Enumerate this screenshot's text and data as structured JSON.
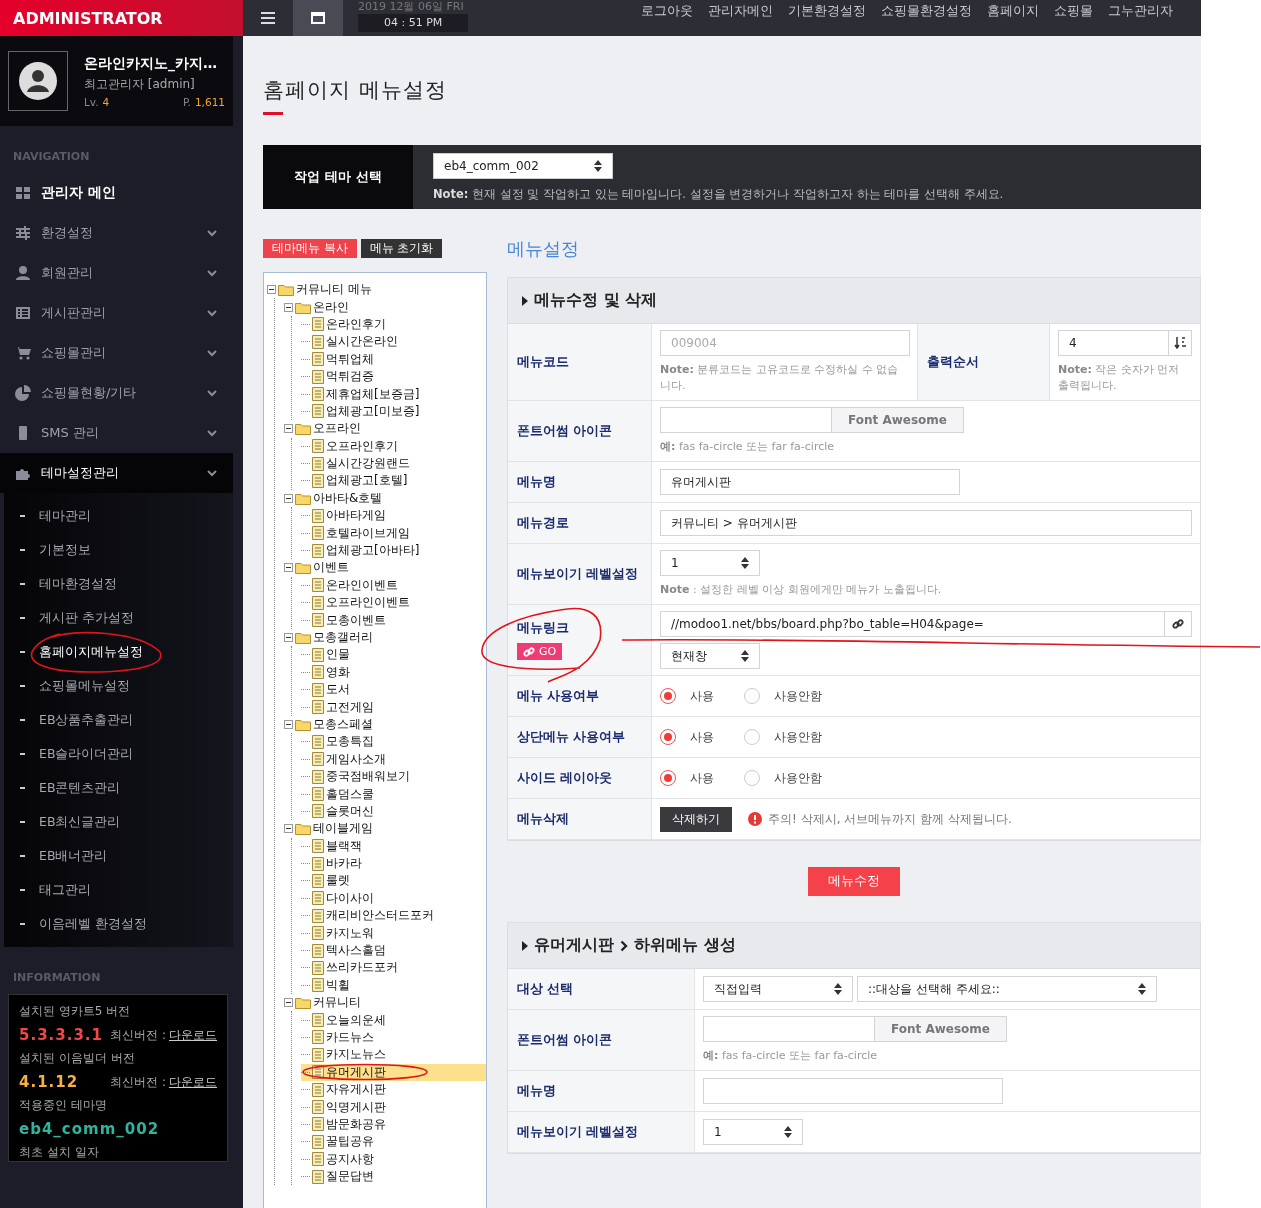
{
  "header": {
    "brand": "ADMINISTRATOR",
    "date": "2019 12월 06일 FRI",
    "time": "04 : 51 PM",
    "links": [
      "로그아웃",
      "관리자메인",
      "기본환경설정",
      "쇼핑몰환경설정",
      "홈페이지",
      "쇼핑몰",
      "그누관리자"
    ]
  },
  "profile": {
    "name": "온라인카지노_카지…",
    "role": "최고관리자 [admin]",
    "lv_label": "Lv.",
    "lv_value": "4",
    "points_label": "P.",
    "points_value": "1,611"
  },
  "navigation": {
    "heading": "NAVIGATION",
    "items": [
      {
        "kind": "link",
        "label": "관리자 메인"
      },
      {
        "kind": "group",
        "label": "환경설정",
        "expanded": false
      },
      {
        "kind": "group",
        "label": "회원관리",
        "expanded": false
      },
      {
        "kind": "group",
        "label": "게시판관리",
        "expanded": false
      },
      {
        "kind": "group",
        "label": "쇼핑몰관리",
        "expanded": false
      },
      {
        "kind": "group",
        "label": "쇼핑몰현황/기타",
        "expanded": false
      },
      {
        "kind": "group",
        "label": "SMS 관리",
        "expanded": false
      },
      {
        "kind": "group",
        "label": "테마설정관리",
        "expanded": true,
        "children": [
          {
            "label": "테마관리",
            "selected": false
          },
          {
            "label": "기본정보",
            "selected": false
          },
          {
            "label": "테마환경설정",
            "selected": false
          },
          {
            "label": "게시판 추가설정",
            "selected": false
          },
          {
            "label": "홈페이지메뉴설정",
            "selected": true
          },
          {
            "label": "쇼핑몰메뉴설정",
            "selected": false
          },
          {
            "label": "EB상품추출관리",
            "selected": false
          },
          {
            "label": "EB슬라이더관리",
            "selected": false
          },
          {
            "label": "EB콘텐츠관리",
            "selected": false
          },
          {
            "label": "EB최신글관리",
            "selected": false
          },
          {
            "label": "EB배너관리",
            "selected": false
          },
          {
            "label": "태그관리",
            "selected": false
          },
          {
            "label": "이음레벨 환경설정",
            "selected": false
          }
        ]
      }
    ]
  },
  "information": {
    "heading": "INFORMATION",
    "items": [
      {
        "label": "설치된 영카트5 버전",
        "value": "5.3.3.3.1",
        "color": "#f04848",
        "latest": "최신버전 :",
        "link": "다운로드"
      },
      {
        "label": "설치된 이음빌더 버전",
        "value": "4.1.12",
        "color": "#f8b042",
        "latest": "최신버전 :",
        "link": "다운로드"
      },
      {
        "label": "적용중인 테마명",
        "value": "eb4_comm_002",
        "color": "#2db59e"
      },
      {
        "label": "최초 설치 일자"
      }
    ]
  },
  "page_title": "홈페이지 메뉴설정",
  "theme_bar": {
    "label": "작업 테마 선택",
    "value": "eb4_comm_002",
    "note": "**Note:** 현재 설정 및 작업하고 있는 테마입니다. 설정을 변경하거나 작업하고자 하는 테마를 선택해 주세요."
  },
  "tree_buttons": [
    {
      "kind": "copy",
      "label": "테마메뉴 복사"
    },
    {
      "kind": "reset",
      "label": "메뉴 초기화"
    }
  ],
  "tree": {
    "items": [
      {
        "label": "커뮤니티 메뉴",
        "expanded": true,
        "selected": false,
        "children": [
          {
            "label": "온라인",
            "expanded": true,
            "selected": false,
            "children": [
              {
                "label": "온라인후기",
                "selected": false
              },
              {
                "label": "실시간온라인",
                "selected": false
              },
              {
                "label": "먹튀업체",
                "selected": false
              },
              {
                "label": "먹튀검증",
                "selected": false
              },
              {
                "label": "제휴업체[보증금]",
                "selected": false
              },
              {
                "label": "업체광고[미보증]",
                "selected": false
              }
            ]
          },
          {
            "label": "오프라인",
            "expanded": true,
            "selected": false,
            "children": [
              {
                "label": "오프라인후기",
                "selected": false
              },
              {
                "label": "실시간강원랜드",
                "selected": false
              },
              {
                "label": "업체광고[호텔]",
                "selected": false
              }
            ]
          },
          {
            "label": "아바타&호텔",
            "expanded": true,
            "selected": false,
            "children": [
              {
                "label": "아바타게임",
                "selected": false
              },
              {
                "label": "호텔라이브게임",
                "selected": false
              },
              {
                "label": "업체광고[아바타]",
                "selected": false
              }
            ]
          },
          {
            "label": "이벤트",
            "expanded": true,
            "selected": false,
            "children": [
              {
                "label": "온라인이벤트",
                "selected": false
              },
              {
                "label": "오프라인이벤트",
                "selected": false
              },
              {
                "label": "모총이벤트",
                "selected": false
              }
            ]
          },
          {
            "label": "모총갤러리",
            "expanded": true,
            "selected": false,
            "children": [
              {
                "label": "인물",
                "selected": false
              },
              {
                "label": "영화",
                "selected": false
              },
              {
                "label": "도서",
                "selected": false
              },
              {
                "label": "고전게임",
                "selected": false
              }
            ]
          },
          {
            "label": "모총스페셜",
            "expanded": true,
            "selected": false,
            "children": [
              {
                "label": "모총특집",
                "selected": false
              },
              {
                "label": "게임사소개",
                "selected": false
              },
              {
                "label": "중국점배워보기",
                "selected": false
              },
              {
                "label": "홀덤스쿨",
                "selected": false
              },
              {
                "label": "슬롯머신",
                "selected": false
              }
            ]
          },
          {
            "label": "테이블게임",
            "expanded": true,
            "selected": false,
            "children": [
              {
                "label": "블랙잭",
                "selected": false
              },
              {
                "label": "바카라",
                "selected": false
              },
              {
                "label": "룰렛",
                "selected": false
              },
              {
                "label": "다이사이",
                "selected": false
              },
              {
                "label": "캐리비안스터드포커",
                "selected": false
              },
              {
                "label": "카지노워",
                "selected": false
              },
              {
                "label": "텍사스홀덤",
                "selected": false
              },
              {
                "label": "쓰리카드포커",
                "selected": false
              },
              {
                "label": "빅휠",
                "selected": false
              }
            ]
          },
          {
            "label": "커뮤니티",
            "expanded": true,
            "selected": false,
            "children": [
              {
                "label": "오늘의운세",
                "selected": false
              },
              {
                "label": "카드뉴스",
                "selected": false
              },
              {
                "label": "카지노뉴스",
                "selected": false
              },
              {
                "label": "유머게시판",
                "selected": true
              },
              {
                "label": "자유게시판",
                "selected": false
              },
              {
                "label": "익명게시판",
                "selected": false
              },
              {
                "label": "밤문화공유",
                "selected": false
              },
              {
                "label": "꿀팁공유",
                "selected": false
              },
              {
                "label": "공지사항",
                "selected": false
              },
              {
                "label": "질문답변",
                "selected": false
              }
            ]
          }
        ]
      }
    ]
  },
  "menu_settings_title": "메뉴설정",
  "edit_section": {
    "title": "메뉴수정 및 삭제",
    "rows": [
      {
        "kind": "code_order",
        "label": "메뉴코드",
        "value": "009004",
        "disabled": true,
        "note": "**Note:** 분류코드는 고유코드로 수정하실 수 없습니다.",
        "label_2": "출력순서",
        "value_2": "4",
        "note_2": "**Note:** 작은 숫자가 먼저 출력됩니다."
      },
      {
        "kind": "icon_field",
        "label": "폰트어썸 아이콘",
        "button": "Font Awesome",
        "hint": "**예:** fas fa-circle 또는 far fa-circle"
      },
      {
        "kind": "text",
        "label": "메뉴명",
        "value": "유머게시판"
      },
      {
        "kind": "wide_text",
        "label": "메뉴경로",
        "value": "커뮤니티 > 유머게시판"
      },
      {
        "kind": "select",
        "label": "메뉴보이기 레벨설정",
        "value": "1",
        "note": "**Note** : 설정한 레벨 이상 회원에게만 메뉴가 노출됩니다."
      },
      {
        "kind": "link",
        "label": "메뉴링크",
        "badge": "GO",
        "value": "//modoo1.net/bbs/board.php?bo_table=H04&page=",
        "target": "현재창"
      },
      {
        "kind": "radio",
        "label": "메뉴 사용여부",
        "options": [
          {
            "label": "사용",
            "selected": true
          },
          {
            "label": "사용안함",
            "selected": false
          }
        ]
      },
      {
        "kind": "radio",
        "label": "상단메뉴 사용여부",
        "options": [
          {
            "label": "사용",
            "selected": true
          },
          {
            "label": "사용안함",
            "selected": false
          }
        ]
      },
      {
        "kind": "radio",
        "label": "사이드 레이아웃",
        "options": [
          {
            "label": "사용",
            "selected": true
          },
          {
            "label": "사용안함",
            "selected": false
          }
        ]
      },
      {
        "kind": "delete",
        "label": "메뉴삭제",
        "button": "삭제하기",
        "warning": "주의! 삭제시, 서브메뉴까지 함께 삭제됩니다."
      }
    ]
  },
  "submit_button": "메뉴수정",
  "create_section": {
    "parent": "유머게시판",
    "title": "하위메뉴 생성",
    "rows": [
      {
        "kind": "target",
        "label": "대상 선택",
        "value": "직접입력",
        "value_2": "::대상을 선택해 주세요::"
      },
      {
        "kind": "icon_field",
        "label": "폰트어썸 아이콘",
        "button": "Font Awesome",
        "hint": "**예:** fas fa-circle 또는 far fa-circle"
      },
      {
        "kind": "text",
        "label": "메뉴명"
      },
      {
        "kind": "select",
        "label": "메뉴보이기 레벨설정",
        "value": "1"
      }
    ]
  }
}
